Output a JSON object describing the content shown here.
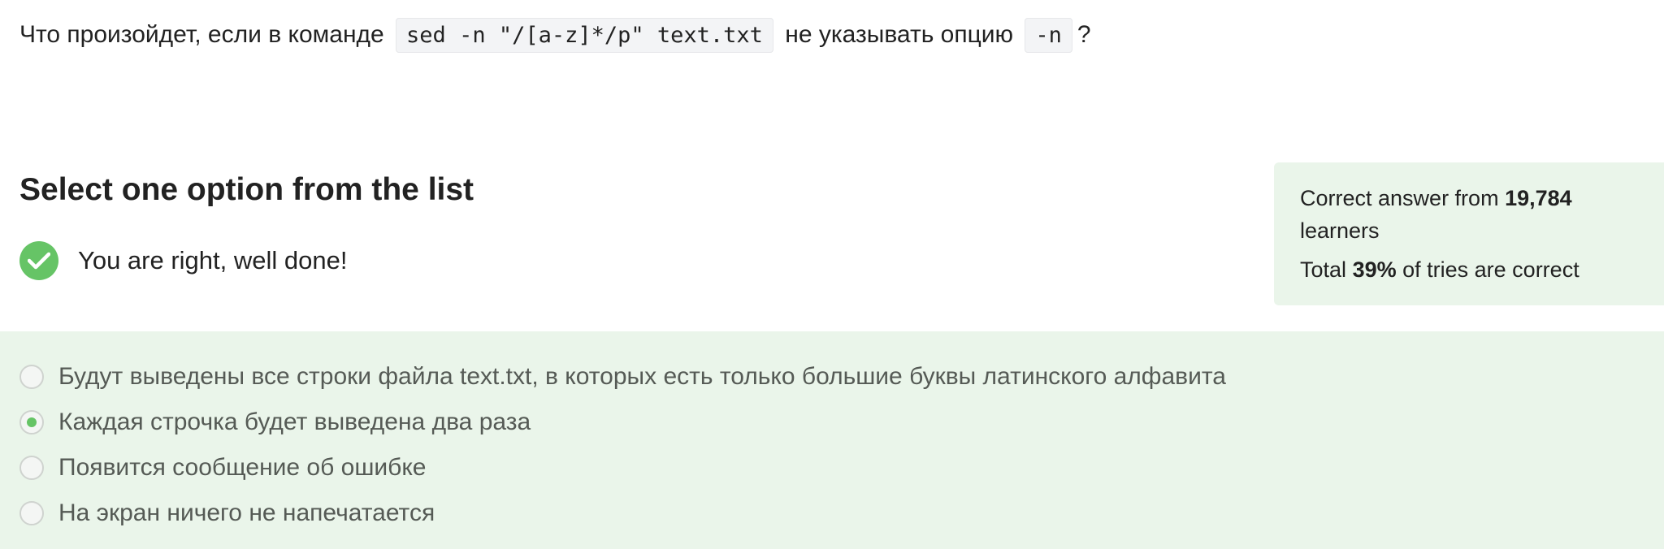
{
  "question": {
    "part1": "Что произойдет, если в команде",
    "code1": "sed -n \"/[a-z]*/p\" text.txt",
    "part2": "не указывать опцию",
    "code2": "-n",
    "part3": "?"
  },
  "heading": "Select one option from the list",
  "feedback": {
    "icon": "check-circle-icon",
    "text": "You are right, well done!"
  },
  "stats": {
    "line1_prefix": "Correct answer from",
    "learners_count": "19,784",
    "line1_suffix": "learners",
    "line2_prefix": "Total",
    "percent": "39%",
    "line2_suffix": "of tries are correct"
  },
  "options": [
    {
      "label": "Будут выведены все строки файла text.txt, в которых есть только большие буквы латинского алфавита",
      "selected": false
    },
    {
      "label": "Каждая строчка будет выведена два раза",
      "selected": true
    },
    {
      "label": "Появится сообщение об ошибке",
      "selected": false
    },
    {
      "label": "На экран ничего не напечатается",
      "selected": false
    }
  ],
  "colors": {
    "accent_green": "#66c466",
    "panel_background": "#eaf5ea"
  }
}
